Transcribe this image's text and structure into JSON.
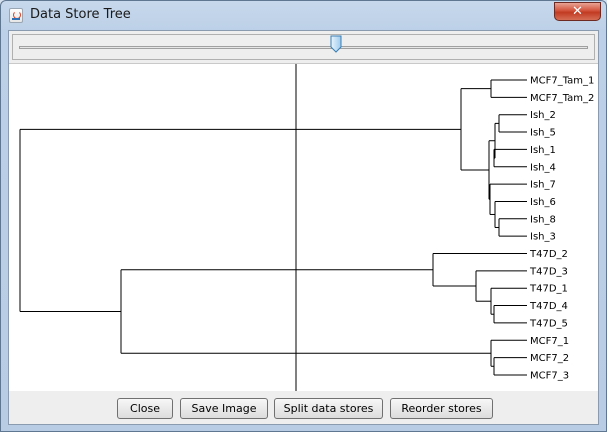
{
  "window": {
    "title": "Data Store Tree",
    "close_symbol": "✕"
  },
  "slider": {
    "position_fraction": 0.557
  },
  "tree": {
    "leaves": [
      "MCF7_Tam_1",
      "MCF7_Tam_2",
      "Ish_2",
      "Ish_5",
      "Ish_1",
      "Ish_4",
      "Ish_7",
      "Ish_6",
      "Ish_8",
      "Ish_3",
      "T47D_2",
      "T47D_3",
      "T47D_1",
      "T47D_4",
      "T47D_5",
      "MCF7_1",
      "MCF7_2",
      "MCF7_3"
    ]
  },
  "buttons": {
    "close": "Close",
    "save_image": "Save Image",
    "split": "Split data stores",
    "reorder": "Reorder stores"
  },
  "colors": {
    "title_bg": "#c7d8ec",
    "close_red": "#c23a22",
    "panel_bg": "#eeeeee",
    "tree_bg": "#ffffff"
  },
  "icons": {
    "app": "java-cup-icon",
    "close": "close-icon",
    "thumb": "slider-thumb-icon"
  }
}
